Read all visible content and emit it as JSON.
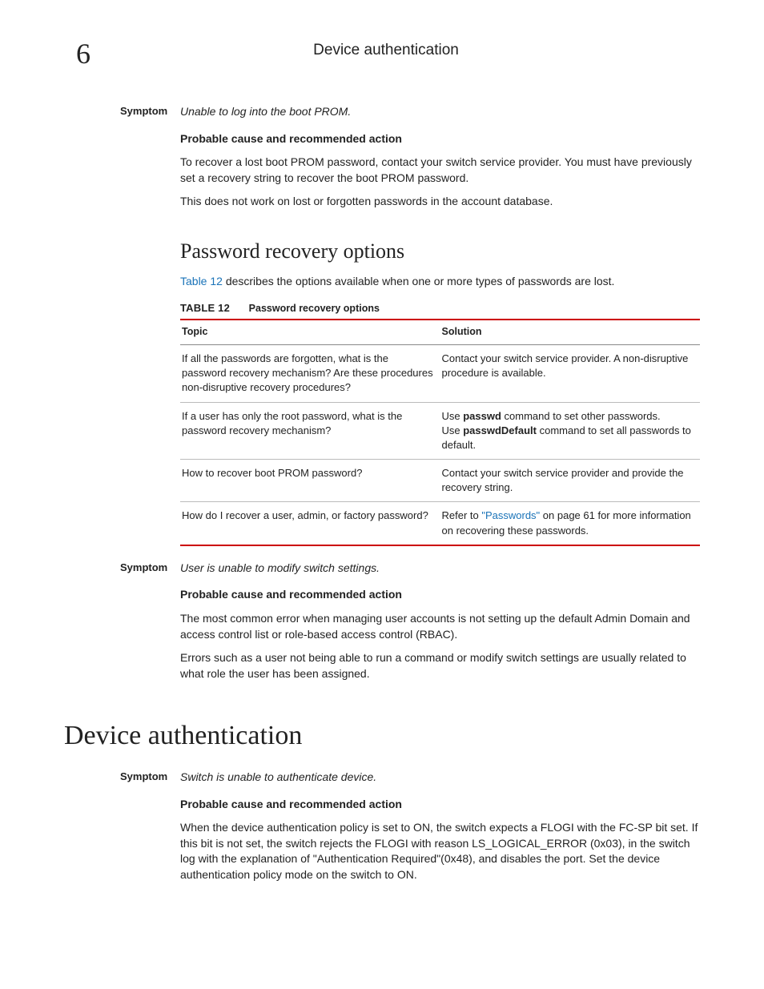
{
  "header": {
    "chapter_number": "6",
    "running_title": "Device authentication"
  },
  "symptom1": {
    "label": "Symptom",
    "text": "Unable to log into the boot PROM.",
    "subhead": "Probable cause and recommended action",
    "para1": "To recover a lost boot PROM password, contact your switch service provider. You must have previously set a recovery string to recover the boot PROM password.",
    "para2": "This does not work on lost or forgotten passwords in the account database."
  },
  "section_recovery": {
    "title": "Password recovery options",
    "intro_link": "Table 12",
    "intro_rest": " describes the options available when one or more types of passwords are lost.",
    "table_label": "TABLE 12",
    "table_title": "Password recovery options",
    "th_topic": "Topic",
    "th_solution": "Solution",
    "rows": [
      {
        "topic": "If all the passwords are forgotten, what is the password recovery mechanism? Are these procedures non-disruptive recovery procedures?",
        "solution_plain": "Contact your switch service provider. A non-disruptive procedure is available."
      },
      {
        "topic": "If a user has only the root password, what is the password recovery mechanism?",
        "solution_l1_a": "Use ",
        "solution_l1_cmd": "passwd",
        "solution_l1_b": " command to set other passwords.",
        "solution_l2_a": "Use ",
        "solution_l2_cmd": "passwdDefault",
        "solution_l2_b": " command to set all passwords to default."
      },
      {
        "topic": "How to recover boot PROM password?",
        "solution_plain": "Contact your switch service provider and provide the recovery string."
      },
      {
        "topic": "How do I recover a user, admin, or factory password?",
        "solution_a": "Refer to ",
        "solution_link": "\"Passwords\"",
        "solution_b": " on page 61 for more information on recovering these passwords."
      }
    ]
  },
  "symptom2": {
    "label": "Symptom",
    "text": "User is unable to modify switch settings.",
    "subhead": "Probable cause and recommended action",
    "para1": "The most common error when managing user accounts is not setting up the default Admin Domain and access control list or role-based access control (RBAC).",
    "para2": "Errors such as a user not being able to run a command or modify switch settings are usually related to what role the user has been assigned."
  },
  "major_section": {
    "title": "Device authentication"
  },
  "symptom3": {
    "label": "Symptom",
    "text": "Switch is unable to authenticate device.",
    "subhead": "Probable cause and recommended action",
    "para1": "When the device authentication policy is set to ON, the switch expects a FLOGI with the FC-SP bit set. If this bit is not set, the switch rejects the FLOGI with reason LS_LOGICAL_ERROR (0x03), in the switch log with the explanation of \"Authentication Required\"(0x48), and disables the port. Set the device authentication policy mode on the switch to ON."
  }
}
